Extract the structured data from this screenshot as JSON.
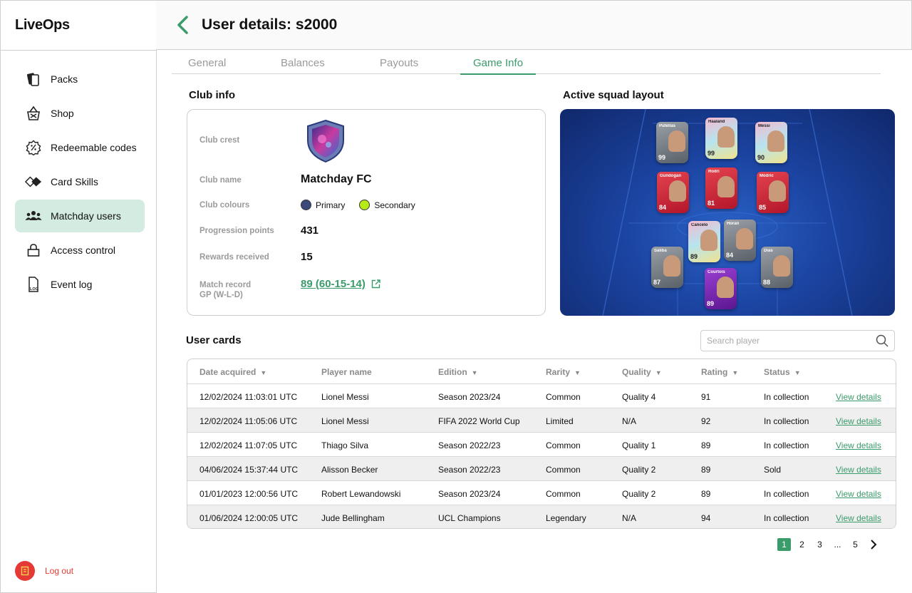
{
  "app": {
    "name": "LiveOps"
  },
  "sidebar": {
    "items": [
      {
        "label": "Packs",
        "icon": "cards-icon"
      },
      {
        "label": "Shop",
        "icon": "basket-icon"
      },
      {
        "label": "Redeemable codes",
        "icon": "discount-badge-icon"
      },
      {
        "label": "Card Skills",
        "icon": "diamond-cards-icon"
      },
      {
        "label": "Matchday users",
        "icon": "users-icon",
        "active": true
      },
      {
        "label": "Access control",
        "icon": "lock-icon"
      },
      {
        "label": "Event log",
        "icon": "log-file-icon"
      }
    ],
    "logout": "Log out"
  },
  "header": {
    "title": "User details: s2000"
  },
  "tabs": [
    "General",
    "Balances",
    "Payouts",
    "Game Info"
  ],
  "active_tab": "Game Info",
  "club_info": {
    "title": "Club info",
    "crest_label": "Club crest",
    "name_label": "Club name",
    "name": "Matchday FC",
    "colours_label": "Club colours",
    "primary_label": "Primary",
    "secondary_label": "Secondary",
    "primary_color": "#3b4a7a",
    "secondary_color": "#b6ea16",
    "progression_label": "Progression points",
    "progression": "431",
    "rewards_label": "Rewards received",
    "rewards": "15",
    "record_label_1": "Match record",
    "record_label_2": "GP (W-L-D)",
    "record": "89 (60-15-14)"
  },
  "squad": {
    "title": "Active squad layout",
    "players": [
      {
        "name": "Putellas",
        "rating": "99",
        "style": "grey"
      },
      {
        "name": "Haaland",
        "rating": "99",
        "style": "holo"
      },
      {
        "name": "Messi",
        "rating": "90",
        "style": "holo"
      },
      {
        "name": "Gundogan",
        "rating": "84",
        "style": "red"
      },
      {
        "name": "Rodri",
        "rating": "81",
        "style": "red"
      },
      {
        "name": "Modric",
        "rating": "85",
        "style": "red"
      },
      {
        "name": "Cancelo",
        "rating": "89",
        "style": "holo"
      },
      {
        "name": "Horan",
        "rating": "84",
        "style": "grey"
      },
      {
        "name": "Saliba",
        "rating": "87",
        "style": "grey"
      },
      {
        "name": "Dias",
        "rating": "88",
        "style": "grey"
      },
      {
        "name": "Courtois",
        "rating": "89",
        "style": "purple"
      }
    ]
  },
  "user_cards": {
    "title": "User cards",
    "search_placeholder": "Search player",
    "columns": [
      "Date acquired",
      "Player name",
      "Edition",
      "Rarity",
      "Quality",
      "Rating",
      "Status"
    ],
    "view_label": "View details",
    "rows": [
      {
        "date": "12/02/2024 11:03:01 UTC",
        "player": "Lionel Messi",
        "edition": "Season 2023/24",
        "rarity": "Common",
        "quality": "Quality 4",
        "rating": "91",
        "status": "In collection"
      },
      {
        "date": "12/02/2024 11:05:06 UTC",
        "player": "Lionel Messi",
        "edition": "FIFA 2022 World Cup",
        "rarity": "Limited",
        "quality": "N/A",
        "rating": "92",
        "status": "In collection"
      },
      {
        "date": "12/02/2024 11:07:05 UTC",
        "player": "Thiago Silva",
        "edition": "Season 2022/23",
        "rarity": "Common",
        "quality": "Quality 1",
        "rating": "89",
        "status": "In collection"
      },
      {
        "date": "04/06/2024 15:37:44 UTC",
        "player": "Alisson Becker",
        "edition": "Season 2022/23",
        "rarity": "Common",
        "quality": "Quality 2",
        "rating": "89",
        "status": "Sold"
      },
      {
        "date": "01/01/2023 12:00:56 UTC",
        "player": "Robert Lewandowski",
        "edition": "Season 2023/24",
        "rarity": "Common",
        "quality": "Quality 2",
        "rating": "89",
        "status": "In collection"
      },
      {
        "date": "01/06/2024 12:00:05 UTC",
        "player": "Jude Bellingham",
        "edition": "UCL Champions",
        "rarity": "Legendary",
        "quality": "N/A",
        "rating": "94",
        "status": "In collection"
      }
    ]
  },
  "pagination": {
    "pages": [
      "1",
      "2",
      "3",
      "...",
      "5"
    ],
    "current": "1"
  }
}
